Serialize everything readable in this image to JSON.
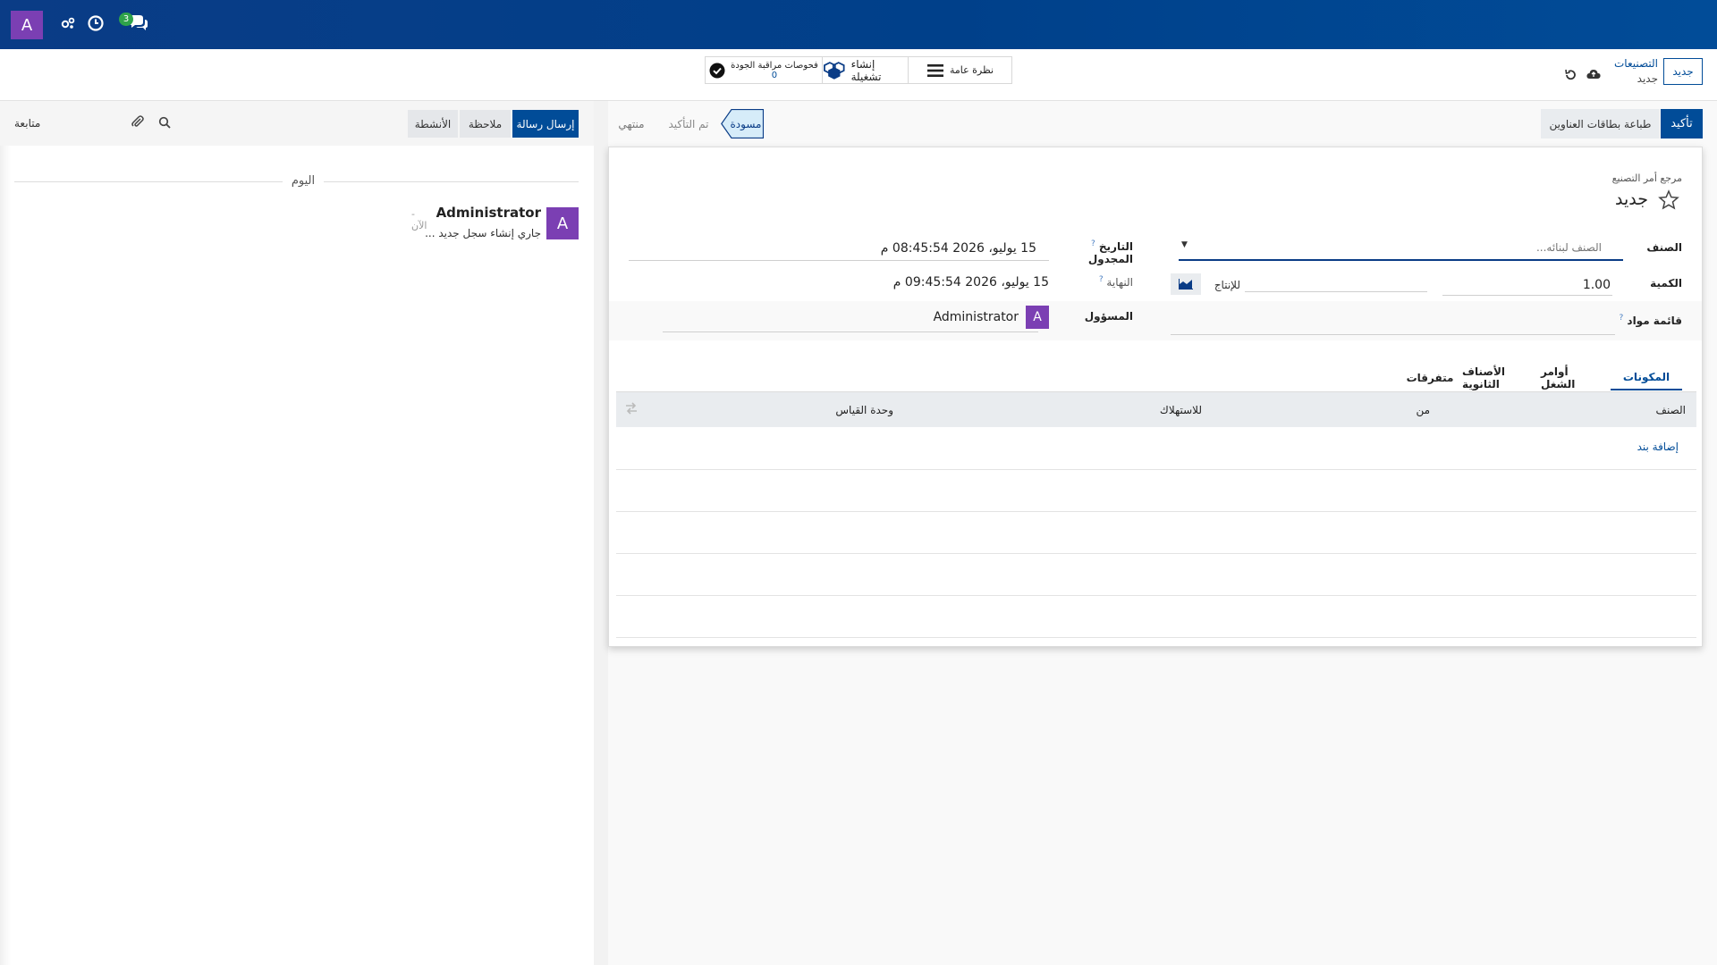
{
  "navbar": {
    "avatar_letter": "A",
    "message_count": "3"
  },
  "control_panel": {
    "new_button": "جديد",
    "breadcrumb_parent": "التصنيعات",
    "breadcrumb_current": "جديد",
    "smart_buttons": {
      "overview": "نظرة عامة",
      "create_batch": "إنشاء تشغيلة",
      "quality_checks_label": "فحوصات مراقبة الجودة",
      "quality_checks_count": "0"
    }
  },
  "statusbar": {
    "confirm_button": "تأكيد",
    "print_labels_button": "طباعة بطاقات العناوين",
    "stages": [
      "مسودة",
      "تم التأكيد",
      "منتهي"
    ]
  },
  "form": {
    "reference_label": "مرجع أمر التصنيع",
    "title": "جديد",
    "product_label": "الصنف",
    "product_placeholder": "الصنف لبنائه...",
    "quantity_label": "الكمية",
    "quantity_value": "1.00",
    "to_produce_label": "للإنتاج",
    "bom_label": "قائمة مواد",
    "scheduled_date_label": "التاريخ المجدول",
    "scheduled_date_value": "15 يوليو، 2026 08:45:54 م",
    "end_label": "النهاية",
    "end_value": "15 يوليو، 2026 09:45:54 م",
    "responsible_label": "المسؤول",
    "responsible_value": "Administrator",
    "responsible_avatar": "A",
    "tabs": [
      "المكونات",
      "أوامر الشغل",
      "الأصناف الثانوية",
      "متفرقات"
    ],
    "table_headers": [
      "الصنف",
      "من",
      "للاستهلاك",
      "وحدة القياس"
    ],
    "add_line": "إضافة بند"
  },
  "chatter": {
    "send_message": "إرسال رسالة",
    "log_note": "ملاحظة",
    "activities": "الأنشطة",
    "follow": "متابعة",
    "today": "اليوم",
    "message": {
      "author": "Administrator",
      "time": "- الآن",
      "body": "جاري إنشاء سجل جديد ...",
      "avatar": "A"
    }
  },
  "colors": {
    "primary": "#014c98",
    "navbar": "#00408a",
    "avatar": "#7b3fb3",
    "badge": "#2fa34a",
    "active_stage": "#d6ecf9"
  }
}
